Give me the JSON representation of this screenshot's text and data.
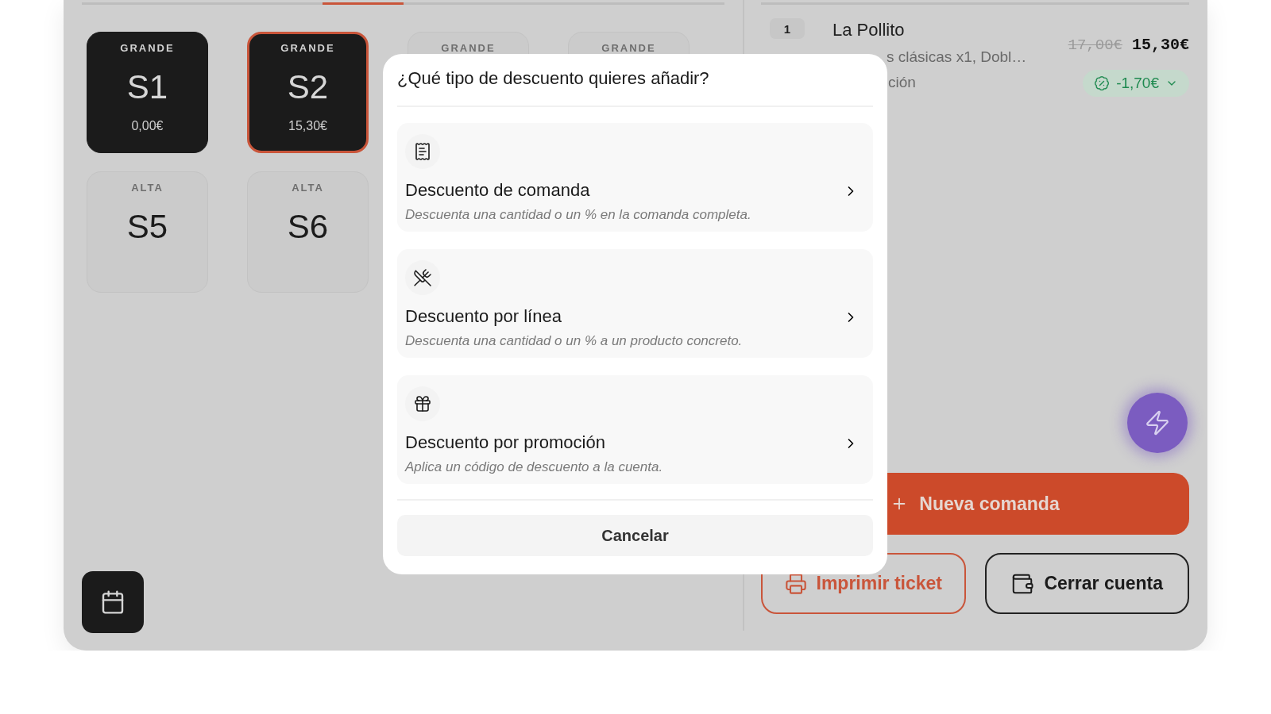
{
  "zone_tabs": [
    {
      "selected": false
    },
    {
      "selected": false
    },
    {
      "selected": false
    },
    {
      "selected": true
    },
    {
      "selected": false
    },
    {
      "selected": false
    },
    {
      "selected": false
    },
    {
      "selected": false
    }
  ],
  "tables": [
    {
      "zone": "GRANDE",
      "name": "S1",
      "amount": "0,00€",
      "occupied": true,
      "selected": false
    },
    {
      "zone": "GRANDE",
      "name": "S2",
      "amount": "15,30€",
      "occupied": true,
      "selected": true
    },
    {
      "zone": "GRANDE",
      "occupied": false,
      "selected": false
    },
    {
      "zone": "GRANDE",
      "occupied": false,
      "selected": false
    },
    {
      "zone": "ALTA",
      "name": "S5",
      "occupied": false,
      "selected": false
    },
    {
      "zone": "ALTA",
      "name": "S6",
      "occupied": false,
      "selected": false
    }
  ],
  "order_line": {
    "quantity": "1",
    "name": "La Pollito",
    "detail": "s clásicas x1, Dobl…",
    "note": "ción",
    "original_price": "17,00€",
    "price": "15,30€",
    "discount": "-1,70€"
  },
  "actions": [
    {
      "kind": "new",
      "label": "Nueva comanda"
    },
    {
      "kind": "print",
      "label": "Imprimir ticket"
    },
    {
      "kind": "close",
      "label": "Cerrar cuenta"
    }
  ],
  "dialog": {
    "title": "¿Qué tipo de descuento quieres añadir?",
    "options": [
      {
        "kind": "order",
        "title": "Descuento de comanda",
        "description": "Descuenta una cantidad o un % en la comanda completa."
      },
      {
        "kind": "line",
        "title": "Descuento por línea",
        "description": "Descuenta una cantidad o un % a un producto concreto."
      },
      {
        "kind": "promo",
        "title": "Descuento por promoción",
        "description": "Aplica un código de descuento a la cuenta."
      }
    ],
    "cancel": "Cancelar"
  }
}
